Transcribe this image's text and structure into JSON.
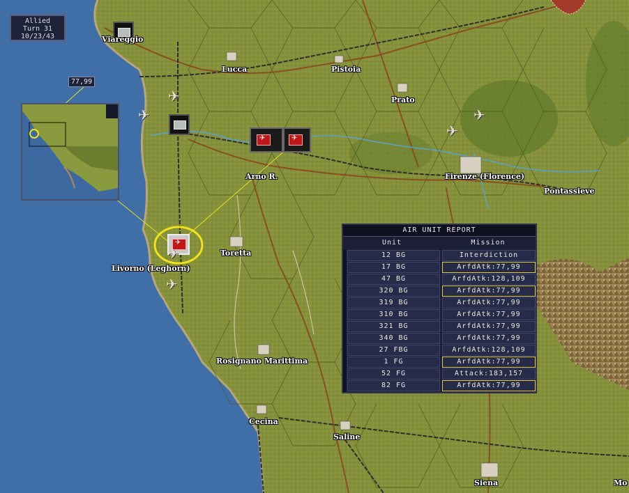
{
  "game": {
    "side": "Allied",
    "turn": "Turn 31",
    "date": "10/23/43"
  },
  "hex_coordinate": "77,99",
  "towns": [
    {
      "id": "viareggio",
      "label": "Viareggio"
    },
    {
      "id": "lucca",
      "label": "Lucca"
    },
    {
      "id": "pistoia",
      "label": "Pistoia"
    },
    {
      "id": "prato",
      "label": "Prato"
    },
    {
      "id": "arno",
      "label": "Arno R."
    },
    {
      "id": "firenze",
      "label": "Firenze (Florence)"
    },
    {
      "id": "pontassieve",
      "label": "Pontassieve"
    },
    {
      "id": "toretta",
      "label": "Toretta"
    },
    {
      "id": "livorno",
      "label": "Livorno (Leghorn)"
    },
    {
      "id": "rosignano",
      "label": "Rosignano Marittima"
    },
    {
      "id": "cecina",
      "label": "Cecina"
    },
    {
      "id": "saline",
      "label": "Saline"
    },
    {
      "id": "siena",
      "label": "Siena"
    },
    {
      "id": "mo",
      "label": "Mo"
    }
  ],
  "report": {
    "title": "AIR UNIT REPORT",
    "col_unit": "Unit",
    "col_mission": "Mission",
    "rows": [
      {
        "unit": "12 BG",
        "mission": "Interdiction",
        "selected": false
      },
      {
        "unit": "17 BG",
        "mission": "ArfdAtk:77,99",
        "selected": true
      },
      {
        "unit": "47 BG",
        "mission": "ArfdAtk:128,109",
        "selected": false
      },
      {
        "unit": "320 BG",
        "mission": "ArfdAtk:77,99",
        "selected": true
      },
      {
        "unit": "319 BG",
        "mission": "ArfdAtk:77,99",
        "selected": false
      },
      {
        "unit": "310 BG",
        "mission": "ArfdAtk:77,99",
        "selected": false
      },
      {
        "unit": "321 BG",
        "mission": "ArfdAtk:77,99",
        "selected": false
      },
      {
        "unit": "340 BG",
        "mission": "ArfdAtk:77,99",
        "selected": false
      },
      {
        "unit": "27 FBG",
        "mission": "ArfdAtk:128,109",
        "selected": false
      },
      {
        "unit": "1 FG",
        "mission": "ArfdAtk:77,99",
        "selected": true
      },
      {
        "unit": "52 FG",
        "mission": "Attack:183,157",
        "selected": false
      },
      {
        "unit": "82 FG",
        "mission": "ArfdAtk:77,99",
        "selected": true
      }
    ]
  },
  "colors": {
    "sea": "#3f6fa6",
    "land": "#7f8c3a",
    "selection_ring": "#f2e21a",
    "target_line": "#e8e020"
  }
}
